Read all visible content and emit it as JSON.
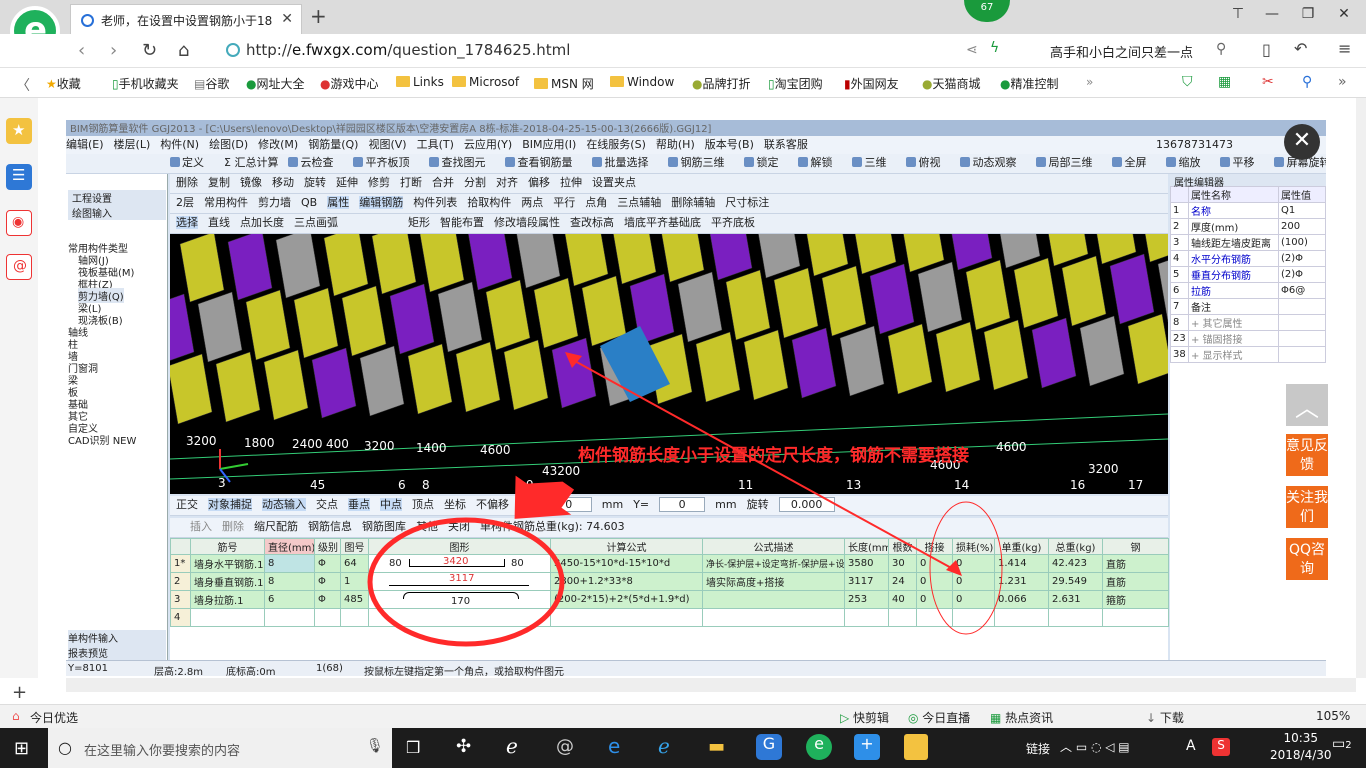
{
  "browser": {
    "tab_title": "老师，在设置中设置钢筋小于18",
    "speed_badge": "67",
    "url_prefix": "http://",
    "url_host": "e.fwxgx.com",
    "url_path": "/question_1784625.html",
    "search_text": "高手和小白之间只差一点",
    "bookmarks": [
      "收藏",
      "手机收藏夹",
      "谷歌",
      "网址大全",
      "游戏中心",
      "Links",
      "Microsof",
      "MSN 网",
      "Window",
      "品牌打折",
      "淘宝团购",
      "外国网友",
      "天猫商城",
      "精准控制"
    ],
    "status_left": "今日优选",
    "status_items": [
      "快剪辑",
      "今日直播",
      "热点资讯",
      "下载",
      "105%"
    ]
  },
  "cad": {
    "title": "BIM钢筋算量软件 GGJ2013 - [C:\\Users\\lenovo\\Desktop\\祥园园区楼区版本\\空港安置房A 8栋-标准-2018-04-25-15-00-13(2666版).GGJ12]",
    "menu": [
      "编辑(E)",
      "楼层(L)",
      "构件(N)",
      "绘图(D)",
      "修改(M)",
      "钢筋量(Q)",
      "视图(V)",
      "工具(T)",
      "云应用(Y)",
      "BIM应用(I)",
      "在线服务(S)",
      "帮助(H)",
      "版本号(B)",
      "联系客服"
    ],
    "account": "13678731473",
    "toolbar1": [
      "定义",
      "Σ 汇总计算",
      "云检查",
      "平齐板顶",
      "查找图元",
      "查看钢筋量",
      "批量选择",
      "钢筋三维",
      "锁定",
      "解锁",
      "三维",
      "俯视",
      "动态观察",
      "局部三维",
      "全屏",
      "缩放",
      "平移",
      "屏幕旋转"
    ],
    "toolbar2": [
      "删除",
      "复制",
      "镜像",
      "移动",
      "旋转",
      "延伸",
      "修剪",
      "打断",
      "合并",
      "分割",
      "对齐",
      "偏移",
      "拉伸",
      "设置夹点"
    ],
    "toolbar3": [
      "2层",
      "常用构件",
      "剪力墙",
      "QB",
      "属性",
      "编辑钢筋",
      "构件列表",
      "拾取构件",
      "两点",
      "平行",
      "点角",
      "三点辅轴",
      "删除辅轴",
      "尺寸标注"
    ],
    "toolbar4": [
      "选择",
      "直线",
      "点加长度",
      "三点画弧",
      "矩形",
      "智能布置",
      "修改墙段属性",
      "查改标高",
      "墙底平齐基础底",
      "平齐底板"
    ],
    "left_panel": {
      "tabs": [
        "工程设置",
        "绘图输入"
      ],
      "items": [
        "常用构件类型",
        "轴网(J)",
        "筏板基础(M)",
        "框柱(Z)",
        "剪力墙(Q)",
        "梁(L)",
        "现浇板(B)",
        "轴线",
        "柱",
        "墙",
        "门窗洞",
        "梁",
        "板",
        "基础",
        "其它",
        "自定义",
        "CAD识别 NEW"
      ],
      "bottom_tabs": [
        "单构件输入",
        "报表预览"
      ]
    },
    "viewport_labels": [
      "3200",
      "1800",
      "2400",
      "400",
      "3200",
      "1400",
      "4600",
      "4600",
      "4600",
      "3200",
      "3",
      "45",
      "6",
      "8",
      "9",
      "11",
      "13",
      "14",
      "16",
      "17",
      "43200"
    ],
    "snap_bar": [
      "正交",
      "对象捕捉",
      "动态输入",
      "交点",
      "垂点",
      "中点",
      "顶点",
      "坐标",
      "不偏移",
      "X=",
      "0",
      "mm",
      "Y=",
      "0",
      "mm",
      "旋转",
      "0.000"
    ],
    "grid_toolbar": [
      "插入",
      "删除",
      "缩尺配筋",
      "钢筋信息",
      "钢筋图库",
      "其他",
      "关闭",
      "单构件钢筋总重(kg): 74.603"
    ],
    "grid_headers": [
      "",
      "筋号",
      "直径(mm)",
      "级别",
      "图号",
      "图形",
      "计算公式",
      "公式描述",
      "长度(mm)",
      "根数",
      "搭接",
      "损耗(%)",
      "单重(kg)",
      "总重(kg)",
      "钢"
    ],
    "grid_rows": [
      {
        "no": "1*",
        "name": "墙身水平钢筋.1",
        "dia": "8",
        "grade": "Φ",
        "fig": "64",
        "shape_l": "80",
        "shape_v": "3420",
        "shape_r": "80",
        "formula": "3450-15*10*d-15*10*d",
        "desc": "净长-保护层+设定弯折-保护层+设定弯折",
        "len": "3580",
        "count": "30",
        "lap": "0",
        "loss": "0",
        "unit": "1.414",
        "total": "42.423",
        "type": "直筋"
      },
      {
        "no": "2",
        "name": "墙身垂直钢筋.1",
        "dia": "8",
        "grade": "Φ",
        "fig": "1",
        "shape_l": "",
        "shape_v": "3117",
        "shape_r": "",
        "formula": "2800+1.2*33*8",
        "desc": "墙实际高度+搭接",
        "len": "3117",
        "count": "24",
        "lap": "0",
        "loss": "0",
        "unit": "1.231",
        "total": "29.549",
        "type": "直筋"
      },
      {
        "no": "3",
        "name": "墙身拉筋.1",
        "dia": "6",
        "grade": "Φ",
        "fig": "485",
        "shape_l": "",
        "shape_v": "170",
        "shape_r": "",
        "formula": "(200-2*15)+2*(5*d+1.9*d)",
        "desc": "",
        "len": "253",
        "count": "40",
        "lap": "0",
        "loss": "0",
        "unit": "0.066",
        "total": "2.631",
        "type": "箍筋"
      },
      {
        "no": "4",
        "name": "",
        "dia": "",
        "grade": "",
        "fig": "",
        "shape_l": "",
        "shape_v": "",
        "shape_r": "",
        "formula": "",
        "desc": "",
        "len": "",
        "count": "",
        "lap": "",
        "loss": "",
        "unit": "",
        "total": "",
        "type": ""
      }
    ],
    "status": [
      "Y=8101",
      "层高:2.8m",
      "底标高:0m",
      "1(68)",
      "按鼠标左键指定第一个角点，或拾取构件图元"
    ],
    "property_editor": {
      "title": "属性编辑器",
      "header": [
        "",
        "属性名称",
        "属性值"
      ],
      "rows": [
        [
          "1",
          "名称",
          "Q1"
        ],
        [
          "2",
          "厚度(mm)",
          "200"
        ],
        [
          "3",
          "轴线距左墙皮距离",
          "(100)"
        ],
        [
          "4",
          "水平分布钢筋",
          "(2)Φ"
        ],
        [
          "5",
          "垂直分布钢筋",
          "(2)Φ"
        ],
        [
          "6",
          "拉筋",
          "Φ6@"
        ],
        [
          "7",
          "备注",
          ""
        ],
        [
          "8",
          "+ 其它属性",
          ""
        ],
        [
          "23",
          "+ 锚固搭接",
          ""
        ],
        [
          "38",
          "+ 显示样式",
          ""
        ]
      ]
    }
  },
  "annotation": "构件钢筋长度小于设置的定尺长度，钢筋不需要搭接",
  "side_buttons": [
    "意见反馈",
    "关注我们",
    "QQ咨询"
  ],
  "taskbar": {
    "search_placeholder": "在这里输入你要搜索的内容",
    "tray_text": "链接",
    "ime": "A",
    "time": "10:35",
    "date": "2018/4/30",
    "notifications": "2"
  },
  "colors": {
    "accent_red": "#ff2a2a",
    "side_orange": "#ef6a1a",
    "grid_green": "#cdf1cd",
    "viewport_bg": "#000000"
  }
}
